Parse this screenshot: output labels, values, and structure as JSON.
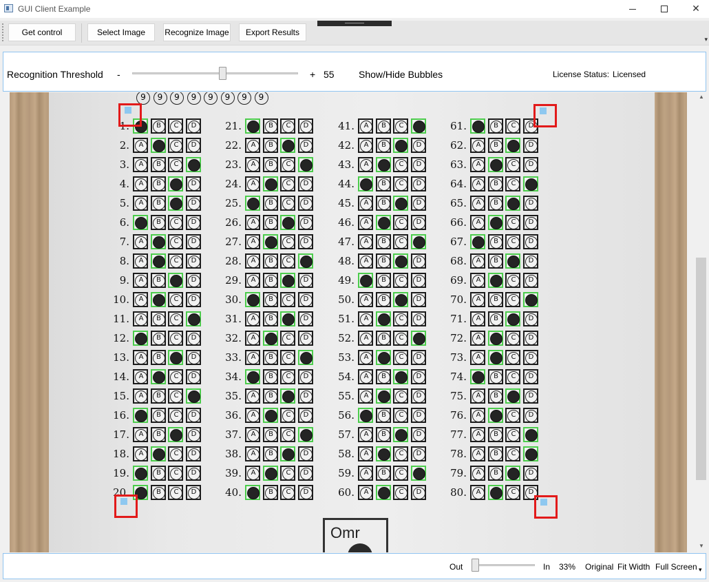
{
  "window": {
    "title": "GUI Client Example",
    "icon": "app-window-icon"
  },
  "toolbar": {
    "get_control": "Get control",
    "select_image": "Select Image",
    "recognize_image": "Recognize Image",
    "export_results": "Export Results"
  },
  "threshold": {
    "label": "Recognition Threshold",
    "minus": "-",
    "plus": "+",
    "value": "55",
    "show_hide": "Show/Hide Bubbles"
  },
  "license": {
    "label": "License Status:",
    "value": "Licensed"
  },
  "sheet": {
    "digits": [
      "9",
      "9",
      "9",
      "9",
      "9",
      "9",
      "9",
      "9"
    ],
    "letters": [
      "A",
      "B",
      "C",
      "D"
    ],
    "answers": [
      {
        "n": "1.",
        "f": 0
      },
      {
        "n": "2.",
        "f": 1
      },
      {
        "n": "3.",
        "f": 3
      },
      {
        "n": "4.",
        "f": 2
      },
      {
        "n": "5.",
        "f": 2
      },
      {
        "n": "6.",
        "f": 0
      },
      {
        "n": "7.",
        "f": 1
      },
      {
        "n": "8.",
        "f": 1
      },
      {
        "n": "9.",
        "f": 2
      },
      {
        "n": "10.",
        "f": 1
      },
      {
        "n": "11.",
        "f": 3
      },
      {
        "n": "12.",
        "f": 0
      },
      {
        "n": "13.",
        "f": 2
      },
      {
        "n": "14.",
        "f": 1
      },
      {
        "n": "15.",
        "f": 3
      },
      {
        "n": "16.",
        "f": 0
      },
      {
        "n": "17.",
        "f": 2
      },
      {
        "n": "18.",
        "f": 1
      },
      {
        "n": "19.",
        "f": 0
      },
      {
        "n": "20.",
        "f": 0
      },
      {
        "n": "21.",
        "f": 0
      },
      {
        "n": "22.",
        "f": 2
      },
      {
        "n": "23.",
        "f": 3
      },
      {
        "n": "24.",
        "f": 1
      },
      {
        "n": "25.",
        "f": 0
      },
      {
        "n": "26.",
        "f": 2
      },
      {
        "n": "27.",
        "f": 1
      },
      {
        "n": "28.",
        "f": 3
      },
      {
        "n": "29.",
        "f": 2
      },
      {
        "n": "30.",
        "f": 0
      },
      {
        "n": "31.",
        "f": 2
      },
      {
        "n": "32.",
        "f": 1
      },
      {
        "n": "33.",
        "f": 3
      },
      {
        "n": "34.",
        "f": 0
      },
      {
        "n": "35.",
        "f": 2
      },
      {
        "n": "36.",
        "f": 1
      },
      {
        "n": "37.",
        "f": 3
      },
      {
        "n": "38.",
        "f": 2
      },
      {
        "n": "39.",
        "f": 1
      },
      {
        "n": "40.",
        "f": 0
      },
      {
        "n": "41.",
        "f": 3
      },
      {
        "n": "42.",
        "f": 2
      },
      {
        "n": "43.",
        "f": 1
      },
      {
        "n": "44.",
        "f": 0
      },
      {
        "n": "45.",
        "f": 2
      },
      {
        "n": "46.",
        "f": 1
      },
      {
        "n": "47.",
        "f": 3
      },
      {
        "n": "48.",
        "f": 2
      },
      {
        "n": "49.",
        "f": 0
      },
      {
        "n": "50.",
        "f": 2
      },
      {
        "n": "51.",
        "f": 1
      },
      {
        "n": "52.",
        "f": 3
      },
      {
        "n": "53.",
        "f": 1
      },
      {
        "n": "54.",
        "f": 2
      },
      {
        "n": "55.",
        "f": 1
      },
      {
        "n": "56.",
        "f": 0
      },
      {
        "n": "57.",
        "f": 2
      },
      {
        "n": "58.",
        "f": 1
      },
      {
        "n": "59.",
        "f": 3
      },
      {
        "n": "60.",
        "f": 1
      },
      {
        "n": "61.",
        "f": 0
      },
      {
        "n": "62.",
        "f": 2
      },
      {
        "n": "63.",
        "f": 1
      },
      {
        "n": "64.",
        "f": 3
      },
      {
        "n": "65.",
        "f": 2
      },
      {
        "n": "66.",
        "f": 1
      },
      {
        "n": "67.",
        "f": 0
      },
      {
        "n": "68.",
        "f": 2
      },
      {
        "n": "69.",
        "f": 1
      },
      {
        "n": "70.",
        "f": 3
      },
      {
        "n": "71.",
        "f": 2
      },
      {
        "n": "72.",
        "f": 1
      },
      {
        "n": "73.",
        "f": 1
      },
      {
        "n": "74.",
        "f": 0
      },
      {
        "n": "75.",
        "f": 2
      },
      {
        "n": "76.",
        "f": 1
      },
      {
        "n": "77.",
        "f": 3
      },
      {
        "n": "78.",
        "f": 3
      },
      {
        "n": "79.",
        "f": 2
      },
      {
        "n": "80.",
        "f": 1
      }
    ],
    "logo_text": "Omr"
  },
  "zoom": {
    "out": "Out",
    "in": "In",
    "percent": "33%",
    "original": "Original",
    "fit_width": "Fit Width",
    "full_screen": "Full Screen"
  },
  "colors": {
    "accent_border": "#8fc3f0",
    "marker_red": "#e21a1a",
    "detected_green": "#4ccc4c",
    "marker_fill": "#8ec8f0"
  }
}
